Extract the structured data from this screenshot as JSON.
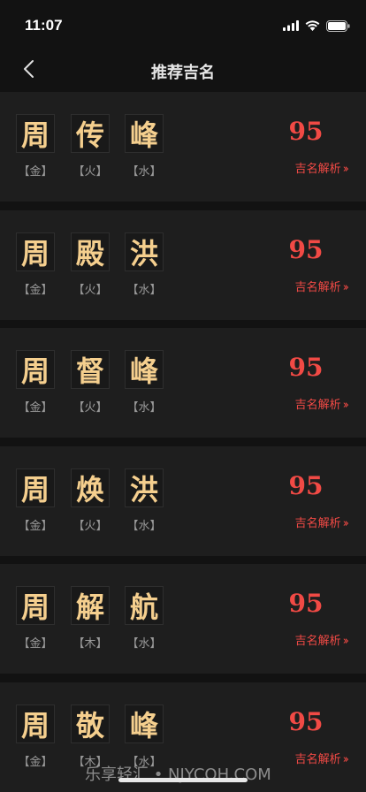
{
  "status": {
    "time": "11:07"
  },
  "nav": {
    "title": "推荐吉名"
  },
  "names": [
    {
      "chars": [
        "周",
        "传",
        "峰"
      ],
      "elements": [
        "【金】",
        "【火】",
        "【水】"
      ],
      "score": "95",
      "link": "吉名解析"
    },
    {
      "chars": [
        "周",
        "殿",
        "洪"
      ],
      "elements": [
        "【金】",
        "【火】",
        "【水】"
      ],
      "score": "95",
      "link": "吉名解析"
    },
    {
      "chars": [
        "周",
        "督",
        "峰"
      ],
      "elements": [
        "【金】",
        "【火】",
        "【水】"
      ],
      "score": "95",
      "link": "吉名解析"
    },
    {
      "chars": [
        "周",
        "焕",
        "洪"
      ],
      "elements": [
        "【金】",
        "【火】",
        "【水】"
      ],
      "score": "95",
      "link": "吉名解析"
    },
    {
      "chars": [
        "周",
        "解",
        "航"
      ],
      "elements": [
        "【金】",
        "【木】",
        "【水】"
      ],
      "score": "95",
      "link": "吉名解析"
    },
    {
      "chars": [
        "周",
        "敬",
        "峰"
      ],
      "elements": [
        "【金】",
        "【木】",
        "【水】"
      ],
      "score": "95",
      "link": "吉名解析"
    }
  ],
  "watermark": "乐享轻汇 • NJYCOH.COM",
  "colors": {
    "gold": "#f5cf8e",
    "red": "#f14a45",
    "card": "#1e1e1e",
    "background": "#121212"
  }
}
